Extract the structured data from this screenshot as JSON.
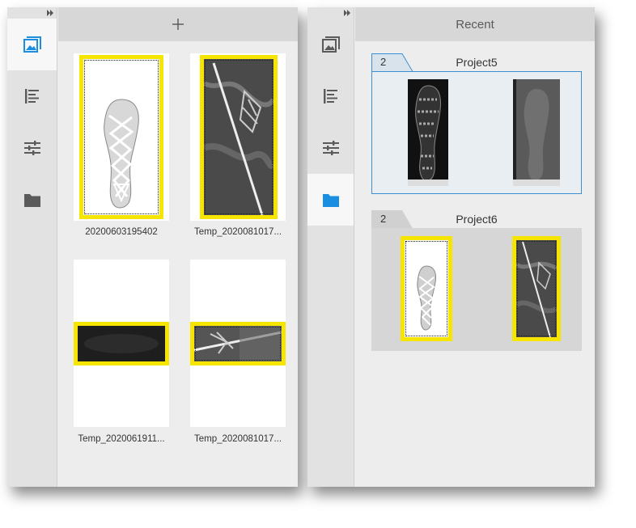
{
  "left_panel": {
    "rail": {
      "collapse_icon": "double-chevron-right-icon",
      "items": [
        {
          "icon": "images-icon",
          "active": true
        },
        {
          "icon": "list-icon",
          "active": false
        },
        {
          "icon": "sliders-icon",
          "active": false
        },
        {
          "icon": "folder-icon",
          "active": false
        }
      ]
    },
    "header": {
      "add_label": "+"
    },
    "thumbnails": [
      {
        "caption": "20200603195402"
      },
      {
        "caption": "Temp_2020081017..."
      },
      {
        "caption": "Temp_2020061911..."
      },
      {
        "caption": "Temp_2020081017..."
      }
    ]
  },
  "right_panel": {
    "rail": {
      "collapse_icon": "double-chevron-right-icon",
      "items": [
        {
          "icon": "images-icon",
          "active": false
        },
        {
          "icon": "list-icon",
          "active": false
        },
        {
          "icon": "sliders-icon",
          "active": false
        },
        {
          "icon": "folder-icon",
          "active": true
        }
      ]
    },
    "header": {
      "title": "Recent"
    },
    "groups": [
      {
        "count": "2",
        "title": "Project5",
        "selected": true
      },
      {
        "count": "2",
        "title": "Project6",
        "selected": false
      }
    ]
  },
  "colors": {
    "accent": "#1a8ee0",
    "highlight_yellow": "#f5e500",
    "icon_gray": "#5a5a5a"
  }
}
